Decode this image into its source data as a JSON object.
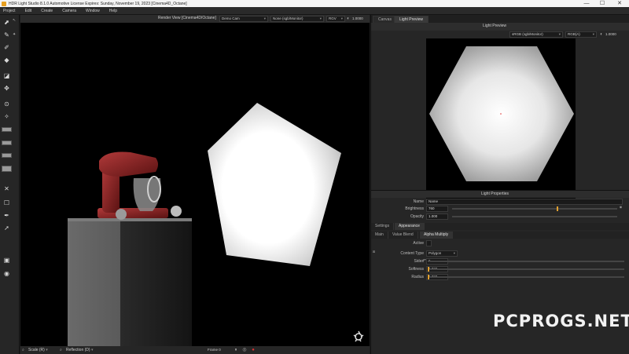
{
  "window": {
    "title": "HDR Light Studio 8.1.0  Automotive License Expires: Sunday, November 19, 2023  [Cinema4D_Octane]",
    "minimize": "—",
    "maximize": "☐",
    "close": "✕"
  },
  "menu": [
    "Project",
    "Edit",
    "Create",
    "Camera",
    "Window",
    "Help"
  ],
  "render_view": {
    "title": "Render View [Cinema4D/Octane]",
    "camera": "Demo Cam",
    "colorspace": "None (sgb/Monitor)",
    "mode": "RGV",
    "value": "1.0000"
  },
  "render_footer": {
    "scale": "Scale (R)",
    "reflection": "Reflection (D)",
    "frame": "Frame 0",
    "pause": "⏸",
    "stop": "●"
  },
  "tabs": [
    "Canvas",
    "Light Preview"
  ],
  "light_preview": {
    "title": "Light Preview",
    "colorspace": "sRGB (sgb/Monitor)",
    "channel": "RGB(A)",
    "value": "1.0000"
  },
  "light_properties": {
    "title": "Light Properties",
    "name_label": "Name",
    "name_value": "Name",
    "brightness_label": "Brightness",
    "brightness_value": "760",
    "opacity_label": "Opacity",
    "opacity_value": "1.000",
    "subtabs": [
      "Settings",
      "Appearance"
    ],
    "subtabs2": [
      "Main",
      "Value Blend",
      "Alpha Multiply"
    ],
    "active_label": "Active",
    "content_type_label": "Content Type",
    "content_type_value": "Polygon",
    "sides_label": "Sides",
    "sides_value": "6",
    "softness_label": "Softness",
    "softness_value": "0.032",
    "radius_label": "Radius",
    "radius_value": "0.000"
  },
  "watermark": "PCPROGS.NET"
}
